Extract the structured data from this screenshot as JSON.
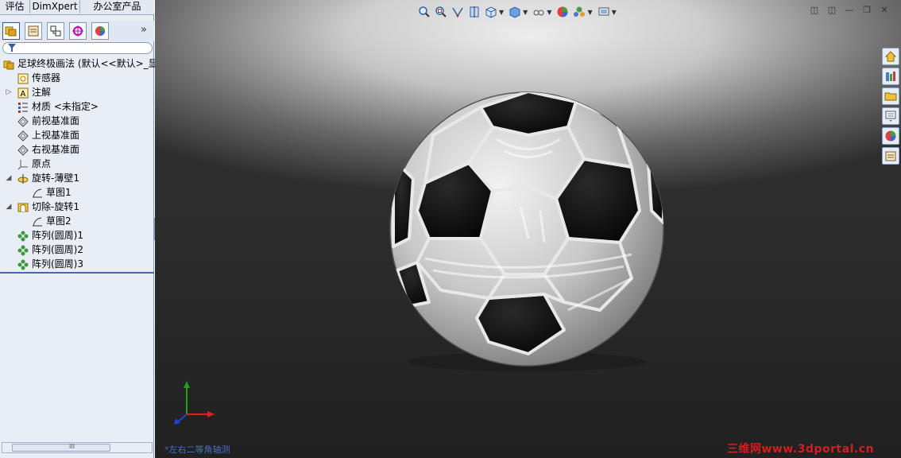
{
  "command_manager_tabs": [
    "评估",
    "DimXpert",
    "办公室产品"
  ],
  "pm_toolbar": {
    "buttons": [
      {
        "icon": "feature-manager-icon"
      },
      {
        "icon": "property-manager-icon"
      },
      {
        "icon": "configuration-manager-icon"
      },
      {
        "icon": "dimxpert-manager-icon"
      },
      {
        "icon": "display-manager-icon"
      }
    ],
    "expand_label": "»"
  },
  "tree": {
    "root": "足球终极画法  (默认<<默认>_显",
    "items": [
      {
        "label": "传感器",
        "icon": "sensor-icon"
      },
      {
        "label": "注解",
        "icon": "annotation-icon"
      },
      {
        "label": "材质 <未指定>",
        "icon": "material-icon"
      },
      {
        "label": "前视基准面",
        "icon": "plane-icon"
      },
      {
        "label": "上视基准面",
        "icon": "plane-icon"
      },
      {
        "label": "右视基准面",
        "icon": "plane-icon"
      },
      {
        "label": "原点",
        "icon": "origin-icon"
      },
      {
        "label": "旋转-薄壁1",
        "icon": "revolve-icon"
      },
      {
        "label": "草图1",
        "icon": "sketch-icon"
      },
      {
        "label": "切除-旋转1",
        "icon": "cut-revolve-icon"
      },
      {
        "label": "草图2",
        "icon": "sketch-icon"
      },
      {
        "label": "阵列(圆周)1",
        "icon": "circular-pattern-icon"
      },
      {
        "label": "阵列(圆周)2",
        "icon": "circular-pattern-icon"
      },
      {
        "label": "阵列(圆周)3",
        "icon": "circular-pattern-icon"
      }
    ]
  },
  "scrollbar": {
    "grip": "III"
  },
  "viewport": {
    "heads_up_icons": [
      "zoom-to-fit-icon",
      "zoom-to-area-icon",
      "previous-view-icon",
      "section-view-icon",
      "view-orientation-icon",
      "display-style-icon",
      "hide-show-icon",
      "edit-appearance-icon",
      "apply-scene-icon",
      "view-settings-icon"
    ],
    "view_label": "*左右二等角轴测",
    "watermark": "三维网www.3dportal.cn"
  },
  "window_controls": [
    "tile-icon",
    "tile-vertical-icon",
    "minimize-icon",
    "restore-icon",
    "close-icon"
  ],
  "task_pane": [
    "home-icon",
    "design-library-icon",
    "file-explorer-icon",
    "view-palette-icon",
    "appearances-icon",
    "custom-properties-icon"
  ],
  "colors": {
    "selection_blue": "#3d6cb4",
    "watermark_red": "#d21e1e",
    "ball_black": "#111111",
    "ball_white": "#d9d9d9"
  }
}
